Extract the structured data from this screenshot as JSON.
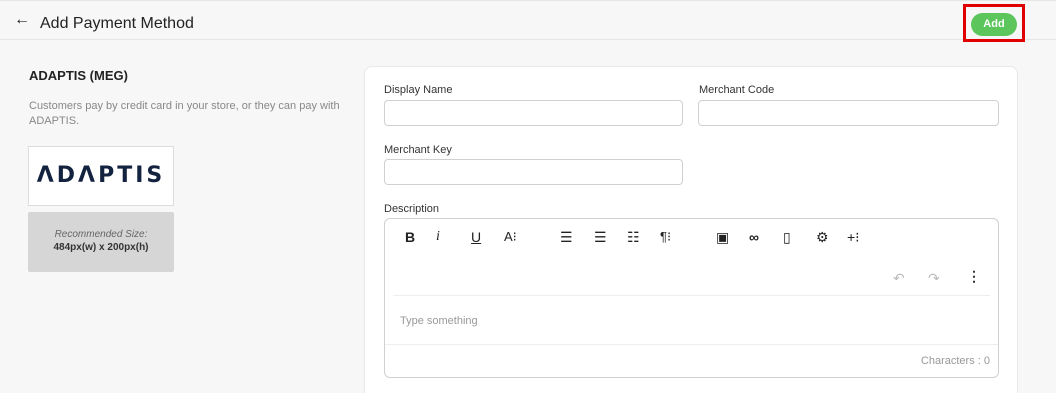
{
  "header": {
    "title": "Add Payment Method",
    "back_icon": "←",
    "add_label": "Add"
  },
  "sidebar": {
    "title": "ADAPTIS (MEG)",
    "description": "Customers pay by credit card in your store, or they can pay with ADAPTIS.",
    "logo_text": "ΛDΛPTIS",
    "recommended_label": "Recommended Size:",
    "recommended_value": "484px(w) x 200px(h)"
  },
  "form": {
    "display_name_label": "Display Name",
    "display_name_value": "",
    "merchant_code_label": "Merchant Code",
    "merchant_code_value": "",
    "merchant_key_label": "Merchant Key",
    "merchant_key_value": "",
    "description_label": "Description"
  },
  "editor": {
    "bold": "B",
    "italic": "i",
    "underline": "U",
    "font_size": "A⁝",
    "align_left": "☰",
    "align_center": "☰",
    "list": "☷",
    "paragraph": "¶⁝",
    "image": "▣",
    "link": "∞",
    "file": "▯",
    "settings": "⚙",
    "more_insert": "+⁝",
    "undo": "↶",
    "redo": "↷",
    "more": "⋮",
    "placeholder": "Type something",
    "char_count": "Characters : 0"
  },
  "colors": {
    "accent": "#5cc55c",
    "highlight": "#e00000"
  }
}
